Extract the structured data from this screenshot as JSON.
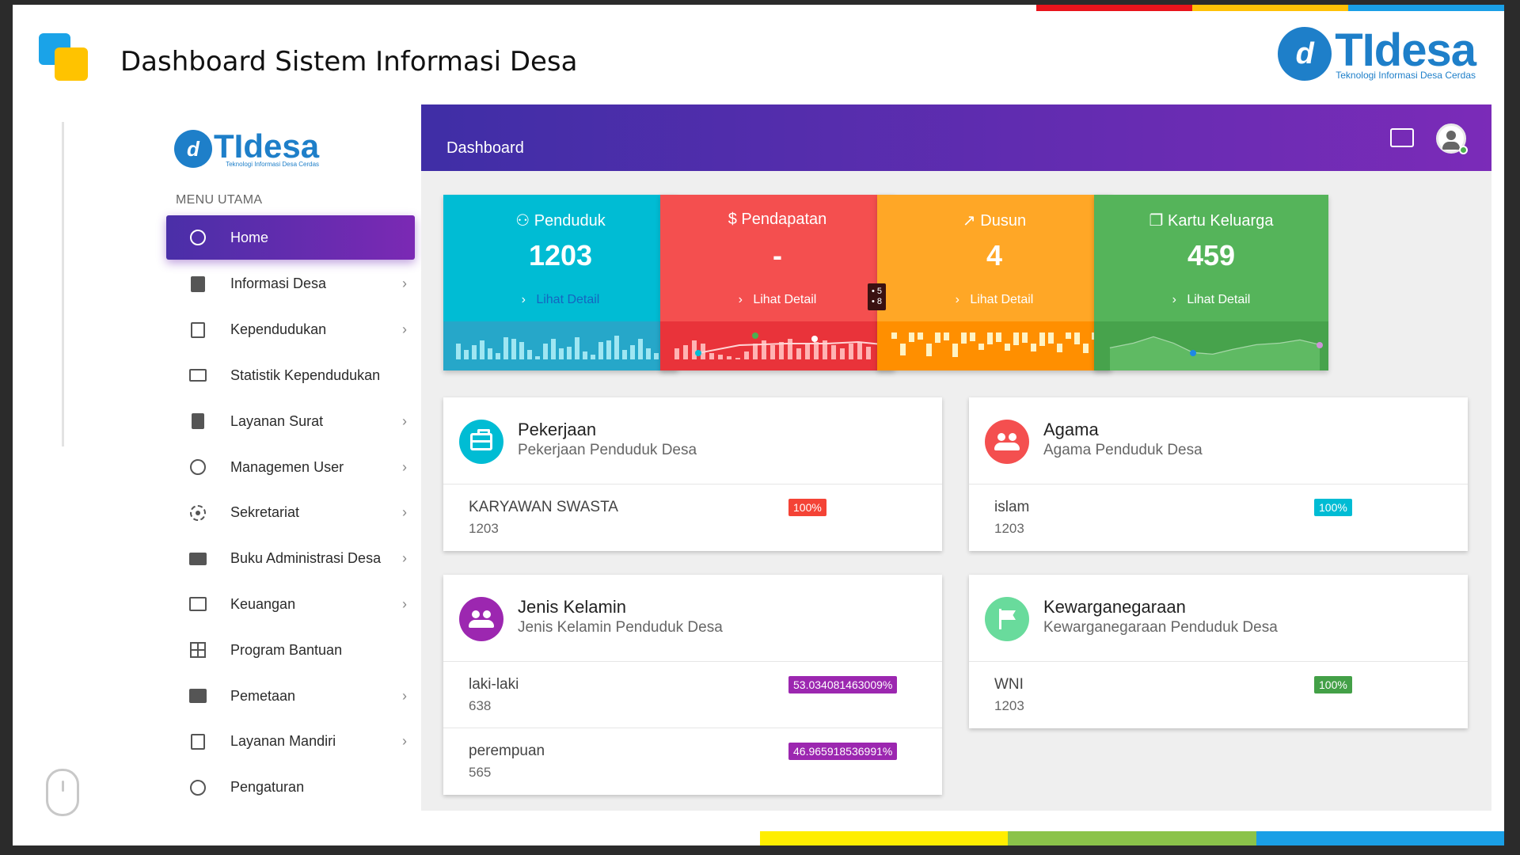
{
  "slide": {
    "title": "Dashboard Sistem Informasi Desa",
    "stripe_top": [
      "#e8141c",
      "#ffc107",
      "#1a9fe6"
    ],
    "stripe_bottom": [
      "#ffee00",
      "#8bc34a",
      "#1a9fe6"
    ]
  },
  "brand": {
    "mark": "d",
    "name_ti": "TI",
    "name_desa": "desa",
    "tagline": "Teknologi Informasi Desa Cerdas",
    "color": "#1e7fc9"
  },
  "sidebar": {
    "heading": "MENU UTAMA",
    "items": [
      {
        "label": "Home",
        "icon": "home-icon",
        "active": true,
        "chevron": false
      },
      {
        "label": "Informasi Desa",
        "icon": "list-icon",
        "chevron": true
      },
      {
        "label": "Kependudukan",
        "icon": "clipboard-icon",
        "chevron": true
      },
      {
        "label": "Statistik Kependudukan",
        "icon": "chart-list-icon",
        "chevron": false
      },
      {
        "label": "Layanan Surat",
        "icon": "book-icon",
        "chevron": true
      },
      {
        "label": "Managemen User",
        "icon": "face-icon",
        "chevron": true
      },
      {
        "label": "Sekretariat",
        "icon": "target-icon",
        "chevron": true
      },
      {
        "label": "Buku Administrasi Desa",
        "icon": "open-book-icon",
        "chevron": true
      },
      {
        "label": "Keuangan",
        "icon": "cast-icon",
        "chevron": true
      },
      {
        "label": "Program Bantuan",
        "icon": "grid-icon",
        "chevron": false
      },
      {
        "label": "Pemetaan",
        "icon": "map-icon",
        "chevron": true
      },
      {
        "label": "Layanan Mandiri",
        "icon": "add-box-icon",
        "chevron": true
      },
      {
        "label": "Pengaturan",
        "icon": "help-icon",
        "chevron": false
      }
    ],
    "chevron_glyph": "›"
  },
  "header": {
    "title": "Dashboard",
    "gradient_start": "#3f2ea6",
    "gradient_end": "#7b2bb8"
  },
  "stats": [
    {
      "key": "penduduk",
      "icon": "person-icon",
      "icon_glyph": "⚇",
      "title": "Penduduk",
      "value": "1203",
      "link": "Lihat Detail",
      "color": "#00bcd4",
      "chart_color": "#26a7c9"
    },
    {
      "key": "pendapatan",
      "icon": "dollar-icon",
      "icon_glyph": "$",
      "title": "Pendapatan",
      "value": "-",
      "link": "Lihat Detail",
      "color": "#f44f4f",
      "chart_color": "#e9333a"
    },
    {
      "key": "dusun",
      "icon": "trending-up-icon",
      "icon_glyph": "↗",
      "title": "Dusun",
      "value": "4",
      "link": "Lihat Detail",
      "color": "#ffa726",
      "chart_color": "#ff8f00"
    },
    {
      "key": "kk",
      "icon": "copy-icon",
      "icon_glyph": "❐",
      "title": "Kartu Keluarga",
      "value": "459",
      "link": "Lihat Detail",
      "color": "#55b45a",
      "chart_color": "#47a34c"
    }
  ],
  "tooltip": {
    "line1": "• 5",
    "line2": "• 8"
  },
  "panels": {
    "pekerjaan": {
      "title": "Pekerjaan",
      "subtitle": "Pekerjaan Penduduk Desa",
      "badge_color": "#00bcd4",
      "rows": [
        {
          "name": "KARYAWAN SWASTA",
          "count": "1203",
          "pct": "100%",
          "pct_color": "#f44336"
        }
      ]
    },
    "agama": {
      "title": "Agama",
      "subtitle": "Agama Penduduk Desa",
      "badge_color": "#f44f4f",
      "rows": [
        {
          "name": "islam",
          "count": "1203",
          "pct": "100%",
          "pct_color": "#00bcd4"
        }
      ]
    },
    "kelamin": {
      "title": "Jenis Kelamin",
      "subtitle": "Jenis Kelamin Penduduk Desa",
      "badge_color": "#9c27b0",
      "rows": [
        {
          "name": "laki-laki",
          "count": "638",
          "pct": "53.034081463009%",
          "pct_color": "#9c27b0"
        },
        {
          "name": "perempuan",
          "count": "565",
          "pct": "46.965918536991%",
          "pct_color": "#9c27b0"
        }
      ]
    },
    "warga": {
      "title": "Kewarganegaraan",
      "subtitle": "Kewarganegaraan Penduduk Desa",
      "badge_color": "#69db9c",
      "rows": [
        {
          "name": "WNI",
          "count": "1203",
          "pct": "100%",
          "pct_color": "#43a047"
        }
      ]
    }
  }
}
